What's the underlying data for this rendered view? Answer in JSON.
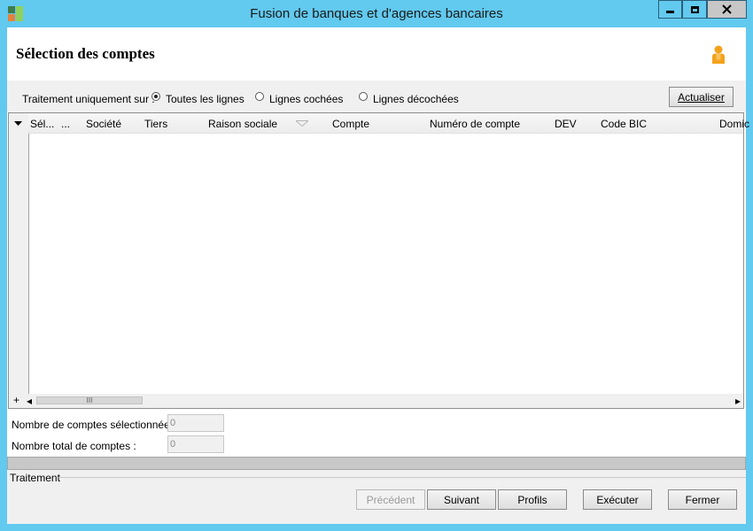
{
  "window": {
    "title": "Fusion de banques et d'agences bancaires",
    "minimize_glyph": "–",
    "maximize_glyph": "□",
    "close_glyph": "✕"
  },
  "header": {
    "title": "Sélection des comptes",
    "icon": "user-icon"
  },
  "filter": {
    "label": "Traitement uniquement sur :",
    "options": [
      {
        "label": "Toutes les lignes",
        "selected": true
      },
      {
        "label": "Lignes cochées",
        "selected": false
      },
      {
        "label": "Lignes décochées",
        "selected": false
      }
    ],
    "refresh_label": "Actualiser"
  },
  "grid": {
    "columns": [
      "Sél...",
      "...",
      "Société",
      "Tiers",
      "Raison sociale",
      "Compte",
      "Numéro de compte",
      "DEV",
      "Code BIC",
      "Domic"
    ],
    "rows": [],
    "add_glyph": "+",
    "scroll_left_glyph": "◂",
    "scroll_right_glyph": "▸",
    "thumb_glyph": "III"
  },
  "counts": {
    "selected_label": "Nombre de comptes sélectionnées :",
    "selected_value": "0",
    "total_label": "Nombre total de comptes :",
    "total_value": "0"
  },
  "footer": {
    "section_label": "Traitement",
    "buttons": {
      "previous": "Précédent",
      "next": "Suivant",
      "profiles": "Profils",
      "execute": "Exécuter",
      "close": "Fermer"
    }
  },
  "colors": {
    "window_frame": "#62c9ef",
    "panel": "#f0f0f0"
  }
}
